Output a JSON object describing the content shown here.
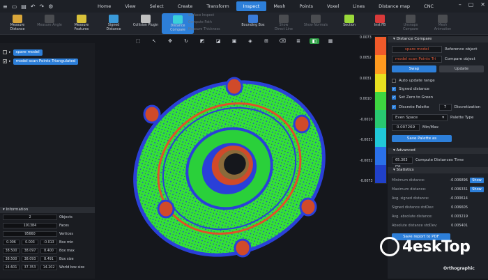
{
  "menu": [
    "Home",
    "View",
    "Select",
    "Create",
    "Transform",
    "Inspect",
    "Mesh",
    "Points",
    "Voxel",
    "Lines",
    "Distance map",
    "CNC"
  ],
  "active_menu": "Inspect",
  "toolbar": [
    {
      "label": "Measure\nDistance",
      "dim": false
    },
    {
      "label": "Measure Angle",
      "dim": true
    },
    {
      "label": "Measure\nFeatures",
      "dim": false
    },
    {
      "label": "Signed\nDistance",
      "dim": false
    },
    {
      "label": "Collision Plugin",
      "dim": false
    },
    {
      "label": "Distance\nCompare",
      "dim": false,
      "sel": true
    },
    {
      "label": "Bounding Box",
      "dim": false
    },
    {
      "label": "Show\nDirect Line",
      "dim": true
    },
    {
      "label": "Show Normals",
      "dim": true
    },
    {
      "label": "Section",
      "dim": false
    },
    {
      "label": "Inst FB",
      "dim": false
    },
    {
      "label": "Unsnaps\nCompare",
      "dim": true
    },
    {
      "label": "Mesh\nAnimation",
      "dim": true
    }
  ],
  "toolbar_small": [
    "Surface Inspect",
    "Compute Path",
    "Measure Thickness"
  ],
  "objects": [
    {
      "name": "spare model",
      "checked": false
    },
    {
      "name": "model scan Points Triangulated",
      "checked": true
    }
  ],
  "info": {
    "title": "Information",
    "objects": "2",
    "objects_label": "Objects",
    "faces": "191384",
    "faces_label": "Faces",
    "vertices": "95660",
    "vertices_label": "Vertices",
    "box_min": [
      "0.006",
      "0.003",
      "-0.013"
    ],
    "box_min_label": "Box min",
    "box_max": [
      "38.500",
      "38.097",
      "8.400"
    ],
    "box_max_label": "Box max",
    "box_size": [
      "38.500",
      "38.093",
      "8.491"
    ],
    "box_size_label": "Box size",
    "world_box_size": [
      "24.601",
      "37.353",
      "14.202"
    ],
    "world_box_size_label": "World box size"
  },
  "scale_ticks": [
    "0.0073",
    "0.0052",
    "0.0031",
    "0.0010",
    "-0.0010",
    "-0.0031",
    "-0.0052",
    "-0.0073"
  ],
  "scale_colors": [
    "#f05a2a",
    "#ff9a1f",
    "#e8e020",
    "#3ed640",
    "#28c870",
    "#20c8d8",
    "#2a70e8",
    "#2040c8"
  ],
  "panel": {
    "title": "Distance Compare",
    "ref_name": "spare model",
    "ref_label": "Reference object",
    "cmp_name": "model scan Points Tri",
    "cmp_label": "Compare object",
    "swap": "Swap",
    "update": "Update",
    "auto_update": "Auto update range",
    "signed": "Signed distance",
    "zero_green": "Set Zero to Green",
    "discrete": "Discrete Palette",
    "disc_value": "7",
    "disc_label": "Discretization",
    "palette_type": "Even Space",
    "palette_type_label": "Palette Type",
    "minmax": "0.007269",
    "minmax_label": "Min/Max",
    "save_palette": "Save Palette as",
    "advanced": "Advanced",
    "time_value": "65.303 ms",
    "time_label": "Compute Distances Time",
    "statistics": "Statistics",
    "stats": [
      {
        "k": "Minimum distance:",
        "v": "-0.006896",
        "btn": "Show"
      },
      {
        "k": "Maximum distance:",
        "v": "0.006331",
        "btn": "Show"
      },
      {
        "k": "Avg. signed distance:",
        "v": "-0.000614"
      },
      {
        "k": "Signed distance stdDev:",
        "v": "0.006605"
      },
      {
        "k": "Avg. absolute distance:",
        "v": "0.003219"
      },
      {
        "k": "Absolute distance stdDev:",
        "v": "0.005401"
      }
    ],
    "save_report": "Save report to PDF"
  },
  "view_mode": "Orthographic",
  "watermark": "4eskTop"
}
